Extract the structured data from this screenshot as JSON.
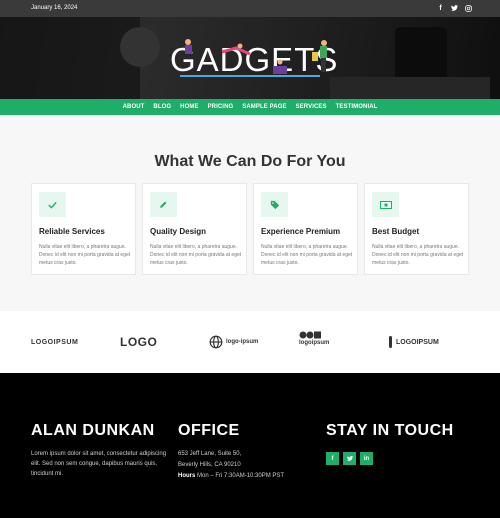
{
  "topbar": {
    "date": "January 16, 2024",
    "social_icons": [
      "facebook-icon",
      "twitter-icon",
      "instagram-icon"
    ]
  },
  "header": {
    "logo_text": "GADGETS"
  },
  "nav": {
    "items": [
      "ABOUT",
      "BLOG",
      "HOME",
      "PRICING",
      "SAMPLE PAGE",
      "SERVICES",
      "TESTIMONIAL"
    ]
  },
  "services": {
    "heading": "What We Can Do For You",
    "cards": [
      {
        "icon": "check-icon",
        "title": "Reliable Services",
        "desc": "Nulla vitae elit libero, a pharetra augue. Donec id elit non mi porta gravida at eget metus cras justo."
      },
      {
        "icon": "pencil-icon",
        "title": "Quality Design",
        "desc": "Nulla vitae elit libero, a pharetra augue. Donec id elit non mi porta gravida at eget metus cras justo."
      },
      {
        "icon": "tag-icon",
        "title": "Experience Premium",
        "desc": "Nulla vitae elit libero, a pharetra augue. Donec id elit non mi porta gravida at eget metus cras justo."
      },
      {
        "icon": "money-icon",
        "title": "Best Budget",
        "desc": "Nulla vitae elit libero, a pharetra augue. Donec id elit non mi porta gravida at eget metus cras justo."
      }
    ]
  },
  "logos": {
    "items": [
      "LOGOIPSUM",
      "LOGO",
      "logo-ipsum",
      "logoipsum",
      "LOGOIPSUM"
    ]
  },
  "footer": {
    "col1": {
      "title": "ALAN DUNKAN",
      "text": "Lorem ipsum dolor sit amet, consectetur adipiscing elit. Sed non sem congue, dapibus mauris quis, tincidunt mi."
    },
    "col2": {
      "title": "OFFICE",
      "line1": "653 Jeff Lane, Suite 50,",
      "line2": "Beverly Hills, CA 90210",
      "hours_label": "Hours",
      "hours_value": "Mon – Fri 7:30AM-10:30PM PST"
    },
    "col3": {
      "title": "STAY IN TOUCH",
      "social": [
        "f",
        "t",
        "in"
      ]
    }
  },
  "colors": {
    "accent": "#1fae6a",
    "footer_bg": "#000000",
    "topbar_bg": "#3a3a3a"
  }
}
